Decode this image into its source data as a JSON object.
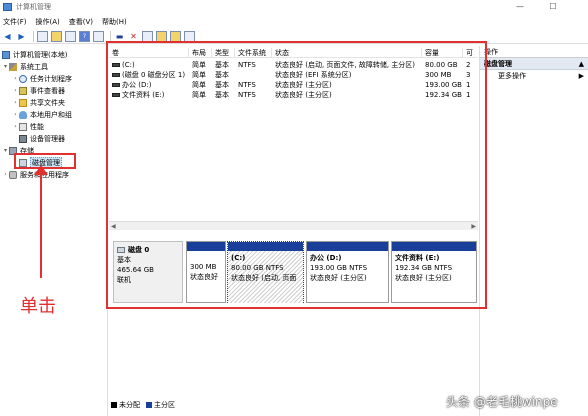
{
  "window": {
    "title": "计算机管理",
    "controls": {
      "minimize": "—",
      "maximize": "☐"
    }
  },
  "menu": [
    "文件(F)",
    "操作(A)",
    "查看(V)",
    "帮助(H)"
  ],
  "tree": {
    "items": [
      {
        "label": "计算机管理(本地)",
        "icon": "computer-icon",
        "expander": "",
        "depth": 0
      },
      {
        "label": "系统工具",
        "icon": "tools-icon",
        "expander": "▾",
        "depth": 1
      },
      {
        "label": "任务计划程序",
        "icon": "clock-icon",
        "expander": "›",
        "depth": 2
      },
      {
        "label": "事件查看器",
        "icon": "event-icon",
        "expander": "›",
        "depth": 2
      },
      {
        "label": "共享文件夹",
        "icon": "folder-icon",
        "expander": "›",
        "depth": 2
      },
      {
        "label": "本地用户和组",
        "icon": "users-icon",
        "expander": "›",
        "depth": 2
      },
      {
        "label": "性能",
        "icon": "perf-icon",
        "expander": "›",
        "depth": 2
      },
      {
        "label": "设备管理器",
        "icon": "devmgr-icon",
        "expander": "",
        "depth": 2
      },
      {
        "label": "存储",
        "icon": "storage-icon",
        "expander": "▾",
        "depth": 1
      },
      {
        "label": "磁盘管理",
        "icon": "disk-icon",
        "expander": "",
        "depth": 2,
        "selected": true
      },
      {
        "label": "服务和应用程序",
        "icon": "services-icon",
        "expander": "›",
        "depth": 1
      }
    ]
  },
  "volumes": {
    "columns": [
      "卷",
      "布局",
      "类型",
      "文件系统",
      "状态",
      "容量",
      "可"
    ],
    "rows": [
      {
        "name": "(C:)",
        "layout": "简单",
        "type": "基本",
        "fs": "NTFS",
        "status": "状态良好 (启动, 页面文件, 故障转储, 主分区)",
        "capacity": "80.00 GB",
        "free": "2"
      },
      {
        "name": "(磁盘 0 磁盘分区 1)",
        "layout": "简单",
        "type": "基本",
        "fs": "",
        "status": "状态良好 (EFI 系统分区)",
        "capacity": "300 MB",
        "free": "3"
      },
      {
        "name": "办公 (D:)",
        "layout": "简单",
        "type": "基本",
        "fs": "NTFS",
        "status": "状态良好 (主分区)",
        "capacity": "193.00 GB",
        "free": "1"
      },
      {
        "name": "文件资料 (E:)",
        "layout": "简单",
        "type": "基本",
        "fs": "NTFS",
        "status": "状态良好 (主分区)",
        "capacity": "192.34 GB",
        "free": "1"
      }
    ]
  },
  "disk": {
    "name": "磁盘 0",
    "type": "基本",
    "size": "465.64 GB",
    "status": "联机",
    "partitions": [
      {
        "name": "",
        "size": "300 MB",
        "status": "状态良好"
      },
      {
        "name": "(C:)",
        "size": "80.00 GB NTFS",
        "status": "状态良好 (启动, 页面"
      },
      {
        "name": "办公 (D:)",
        "size": "193.00 GB NTFS",
        "status": "状态良好 (主分区)"
      },
      {
        "name": "文件资料 (E:)",
        "size": "192.34 GB NTFS",
        "status": "状态良好 (主分区)"
      }
    ]
  },
  "legend": [
    {
      "label": "未分配",
      "color": "#000000"
    },
    {
      "label": "主分区",
      "color": "#1a3f9a"
    }
  ],
  "actions": {
    "header": "操作",
    "section": "磁盘管理",
    "more": "更多操作"
  },
  "annotation": {
    "text": "单击",
    "color": "#e03030"
  },
  "watermark": "头条 @老毛桃winpe"
}
